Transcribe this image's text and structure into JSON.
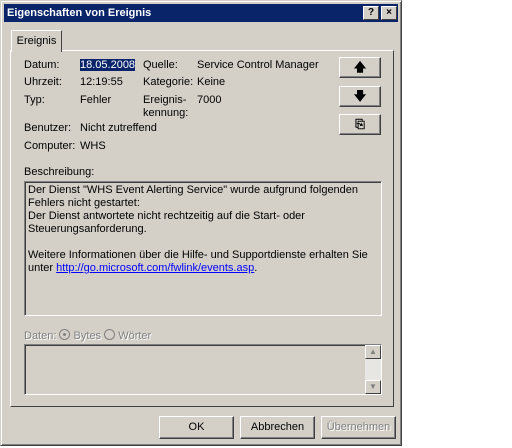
{
  "window": {
    "title": "Eigenschaften von Ereignis",
    "help_label": "?",
    "close_label": "×"
  },
  "tab": {
    "label": "Ereignis"
  },
  "fields": {
    "datum_label": "Datum:",
    "datum_value": "18.05.2008",
    "uhrzeit_label": "Uhrzeit:",
    "uhrzeit_value": "12:19:55",
    "typ_label": "Typ:",
    "typ_value": "Fehler",
    "benutzer_label": "Benutzer:",
    "benutzer_value": "Nicht zutreffend",
    "computer_label": "Computer:",
    "computer_value": "WHS",
    "quelle_label": "Quelle:",
    "quelle_value": "Service Control Manager",
    "kategorie_label": "Kategorie:",
    "kategorie_value": "Keine",
    "kennung_label_1": "Ereignis-",
    "kennung_label_2": "kennung:",
    "kennung_value": "7000"
  },
  "nav_buttons": {
    "up": "🡅",
    "down": "🡇",
    "copy": "⎘"
  },
  "description": {
    "label": "Beschreibung:",
    "line1": "Der Dienst \"WHS Event Alerting Service\" wurde aufgrund folgenden",
    "line2": "Fehlers nicht gestartet:",
    "line3": "Der Dienst antwortete nicht rechtzeitig auf die Start- oder",
    "line4": "Steuerungsanforderung.",
    "line5": "Weitere Informationen über die Hilfe- und Supportdienste erhalten Sie",
    "line6_prefix": "unter",
    "link": "http://go.microsoft.com/fwlink/events.asp",
    "line6_suffix": "."
  },
  "data_section": {
    "label": "Daten:",
    "option_bytes": "Bytes",
    "option_words": "Wörter",
    "selected": "Bytes"
  },
  "buttons": {
    "ok": "OK",
    "cancel": "Abbrechen",
    "apply": "Übernehmen"
  },
  "colors": {
    "titlebar": "#0a246a",
    "face": "#d4d0c8",
    "link": "#0000ff"
  }
}
